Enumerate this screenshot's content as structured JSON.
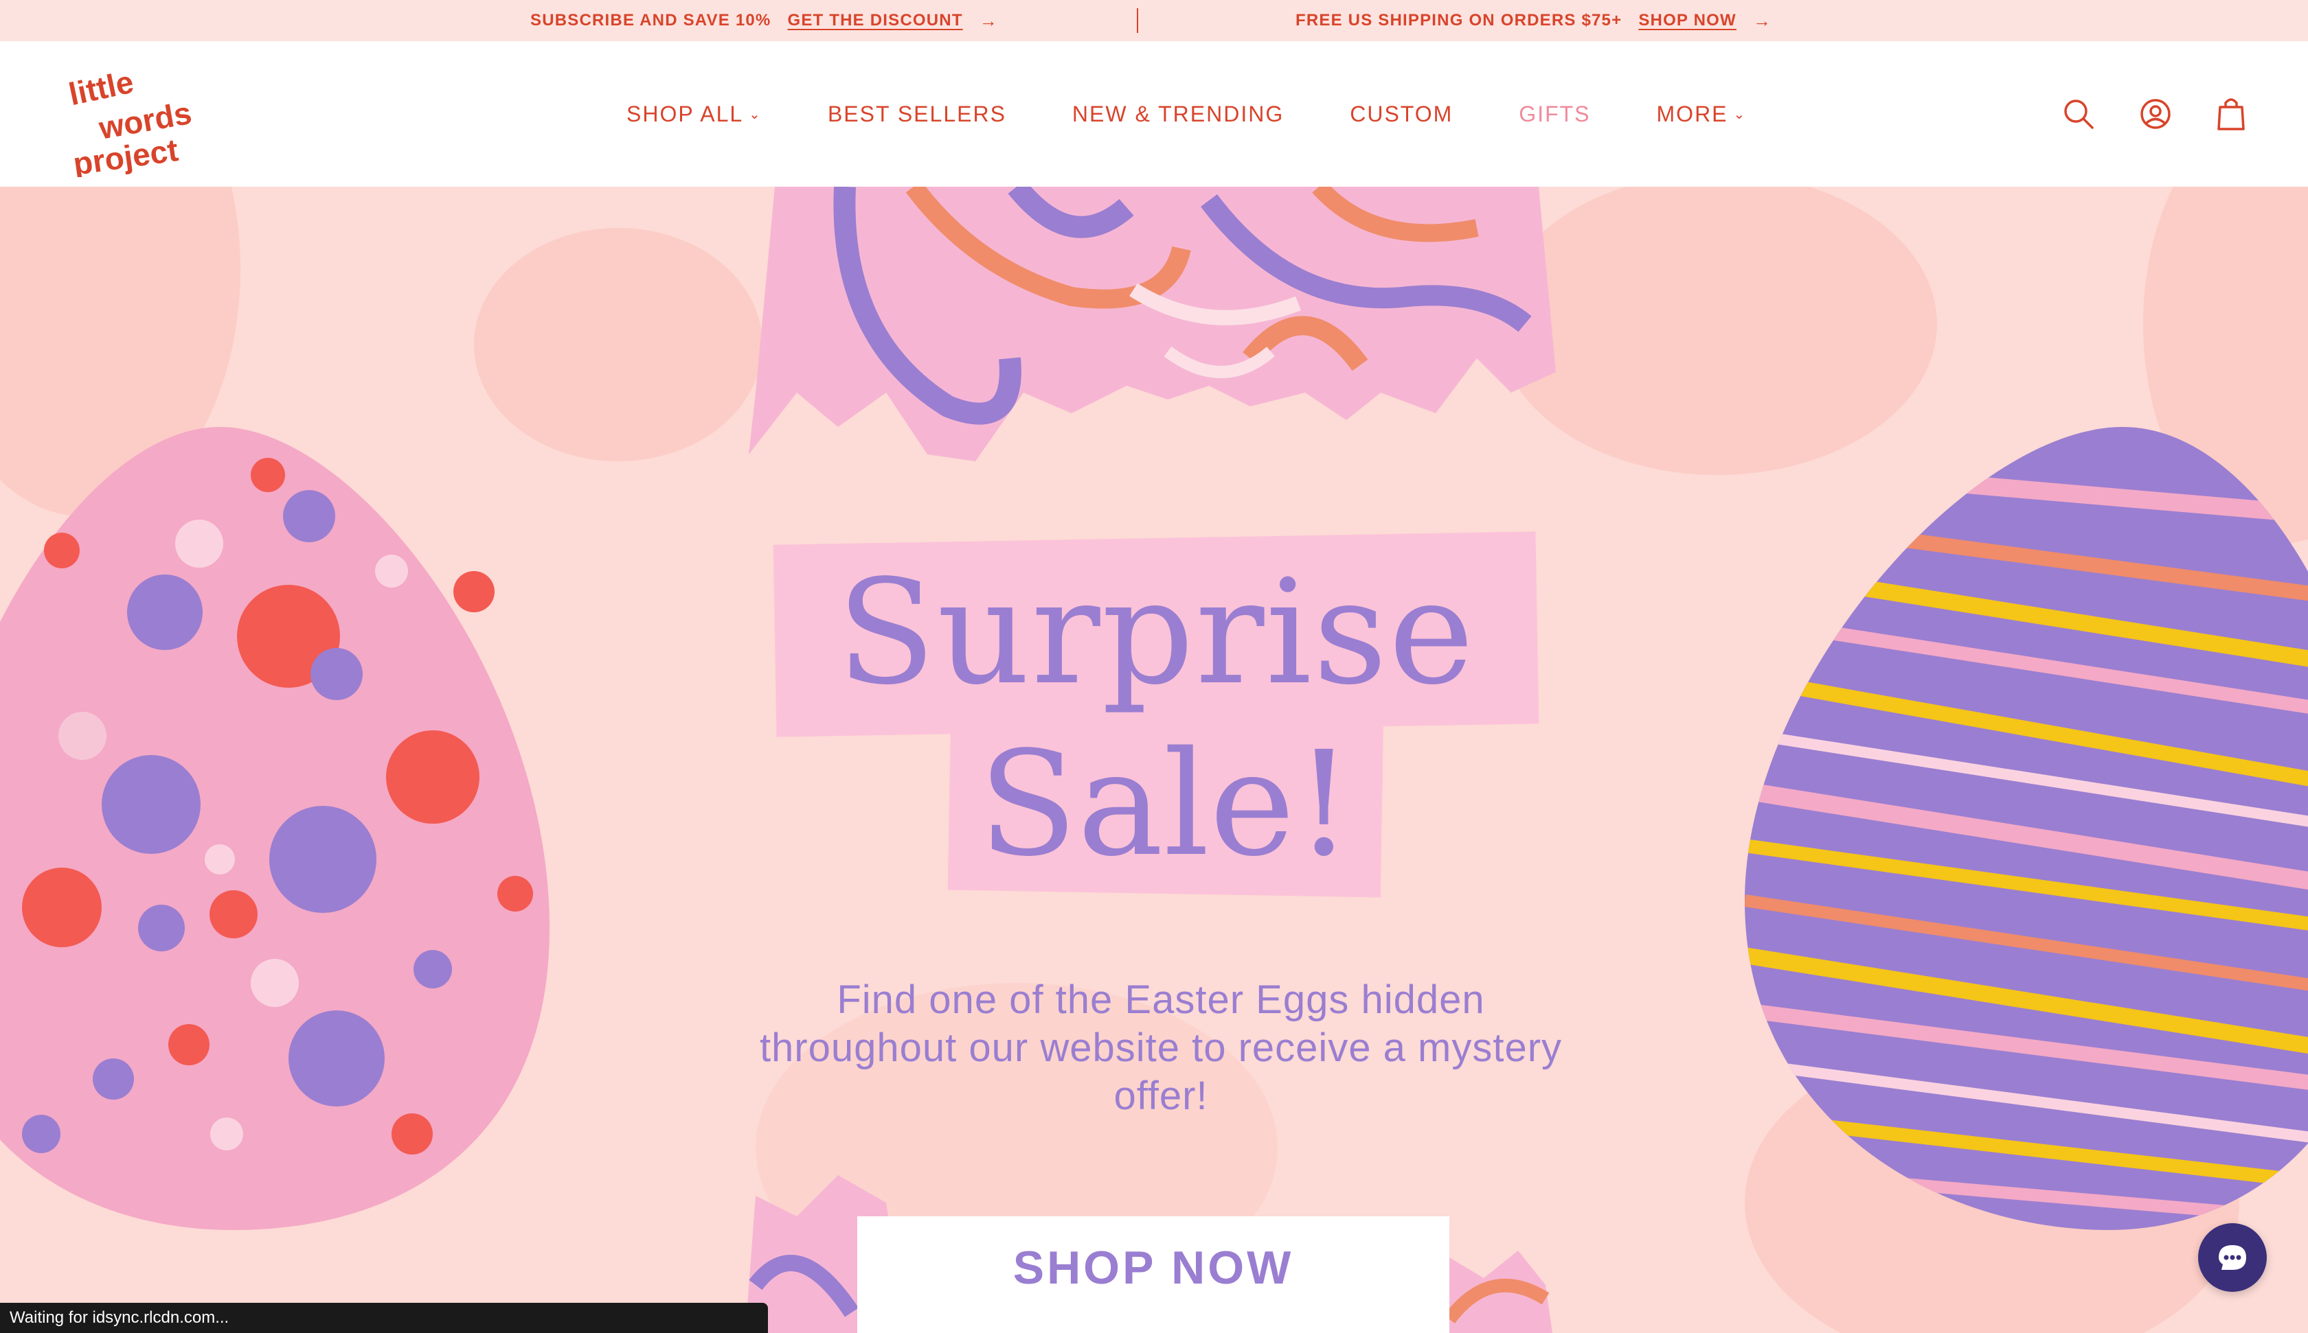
{
  "announcement": {
    "left_text": "SUBSCRIBE AND SAVE 10%",
    "left_link": "GET THE DISCOUNT",
    "right_text": "FREE US SHIPPING ON ORDERS $75+",
    "right_link": "SHOP NOW",
    "arrow": "→"
  },
  "header": {
    "logo": {
      "line1": "little",
      "line2": "words",
      "line3": "project"
    },
    "nav": [
      {
        "label": "SHOP ALL",
        "has_dropdown": true
      },
      {
        "label": "BEST SELLERS",
        "has_dropdown": false
      },
      {
        "label": "NEW & TRENDING",
        "has_dropdown": false
      },
      {
        "label": "CUSTOM",
        "has_dropdown": false
      },
      {
        "label": "GIFTS",
        "has_dropdown": false
      },
      {
        "label": "MORE",
        "has_dropdown": true
      }
    ],
    "caret": "⌄",
    "icons": [
      "search-icon",
      "account-icon",
      "cart-icon"
    ]
  },
  "hero": {
    "headline_line1": "Surprise",
    "headline_line2": "Sale!",
    "subtext": "Find one of the Easter Eggs hidden throughout our website to receive a mystery offer!",
    "cta_label": "SHOP NOW"
  },
  "status_bar": {
    "text": "Waiting for idsync.rlcdn.com..."
  },
  "chat": {
    "icon": "chat-icon"
  },
  "colors": {
    "brand_red": "#d8442b",
    "gifts_pink": "#f08a9c",
    "hero_bg": "#fddbd6",
    "lavender": "#9a7ed1",
    "highlight_pink": "#fbc3d9",
    "chat_bg": "#3b2f7a"
  }
}
